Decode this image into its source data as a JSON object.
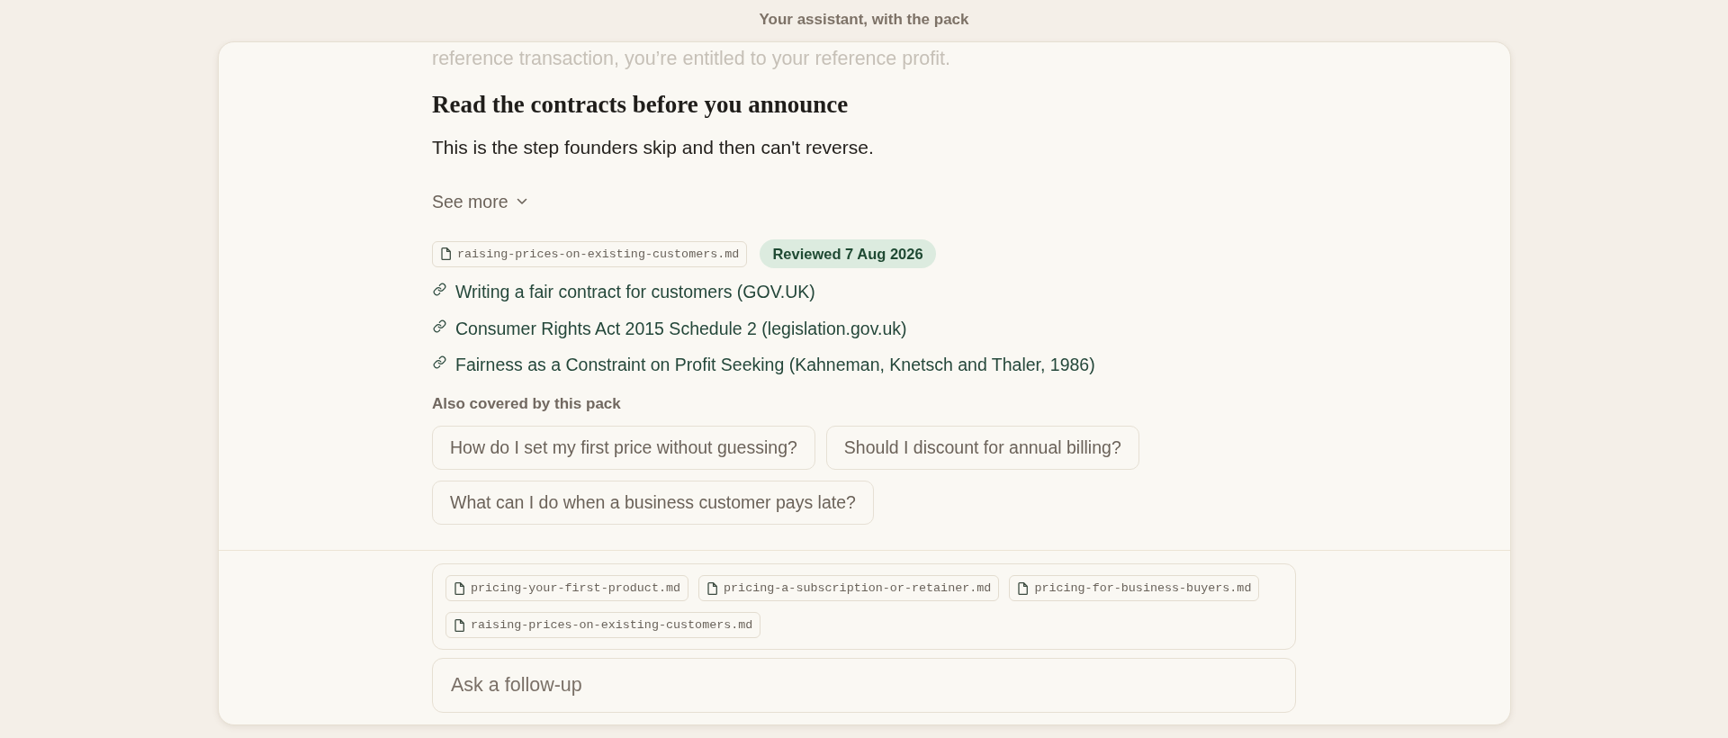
{
  "header": {
    "title": "Your assistant, with the pack"
  },
  "answer": {
    "faded_line": "reference transaction, you’re entitled to your reference profit.",
    "heading": "Read the contracts before you announce",
    "paragraph": "This is the step founders skip and then can't reverse.",
    "see_more": {
      "label": "See more",
      "expanded": false
    }
  },
  "source": {
    "file": "raising-prices-on-existing-customers.md",
    "reviewed": "Reviewed 7 Aug 2026"
  },
  "links": [
    "Writing a fair contract for customers (GOV.UK)",
    "Consumer Rights Act 2015 Schedule 2 (legislation.gov.uk)",
    "Fairness as a Constraint on Profit Seeking (Kahneman, Knetsch and Thaler, 1986)"
  ],
  "also_covered": {
    "label": "Also covered by this pack",
    "questions": [
      "How do I set my first price without guessing?",
      "Should I discount for annual billing?",
      "What can I do when a business customer pays late?"
    ]
  },
  "composer": {
    "attachments": [
      "pricing-your-first-product.md",
      "pricing-a-subscription-or-retainer.md",
      "pricing-for-business-buyers.md",
      "raising-prices-on-existing-customers.md"
    ],
    "placeholder": "Ask a follow-up"
  }
}
